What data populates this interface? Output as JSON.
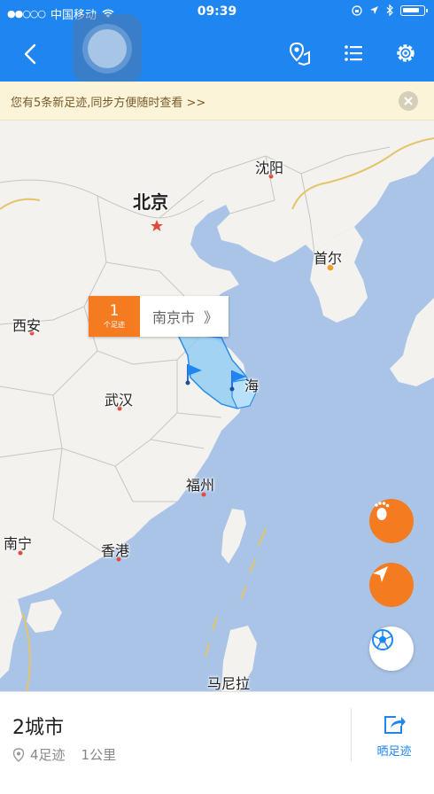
{
  "status_bar": {
    "signal": "●●○○○",
    "carrier": "中国移动",
    "time": "09:39"
  },
  "notice": {
    "text": "您有5条新足迹,同步方便随时查看 >>"
  },
  "map": {
    "cities": {
      "beijing": "北京",
      "shenyang": "沈阳",
      "seoul": "首尔",
      "xian": "西安",
      "wuhan": "武汉",
      "fuzhou": "福州",
      "nanning": "南宁",
      "hongkong": "香港",
      "manila": "马尼拉",
      "shanghai": "海"
    },
    "callout": {
      "count": "1",
      "count_unit": "个足迹",
      "city": "南京市",
      "chevron": "》"
    }
  },
  "summary": {
    "title": "2城市",
    "footprints": "4足迹",
    "distance": "1公里",
    "share_label": "晒足迹"
  },
  "colors": {
    "header_blue": "#1f86f1",
    "accent_orange": "#f47b20",
    "sea": "#aac4e8",
    "land": "#f4f2ee"
  }
}
